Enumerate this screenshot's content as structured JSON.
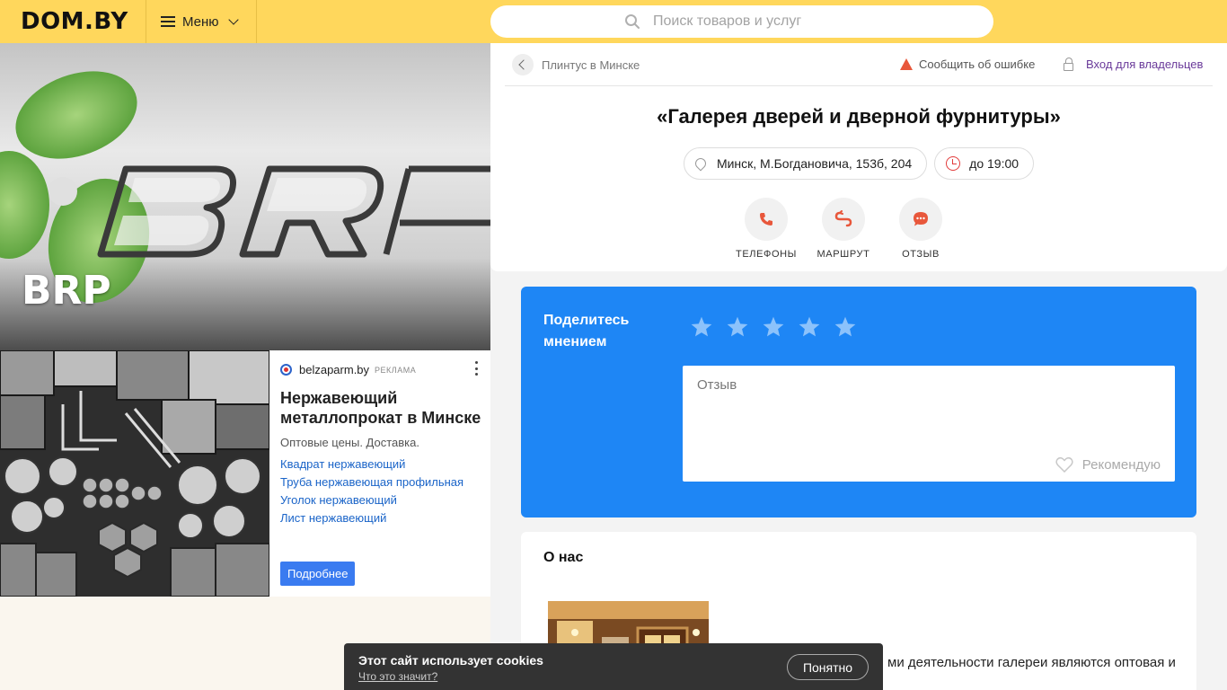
{
  "header": {
    "logo": "DOM.BY",
    "menu_label": "Меню",
    "search_placeholder": "Поиск товаров и услуг"
  },
  "hero": {
    "title": "BRP"
  },
  "ad": {
    "source": "belzaparm.by",
    "tag": "РЕКЛАМА",
    "title": "Нержавеющий металлопрокат в Минске",
    "description": "Оптовые цены. Доставка.",
    "links": [
      "Квадрат нержавеющий",
      "Труба нержавеющая профильная",
      "Уголок нержавеющий",
      "Лист нержавеющий"
    ],
    "button": "Подробнее"
  },
  "card": {
    "breadcrumb": "Плинтус в Минске",
    "report": "Сообщить об ошибке",
    "owners": "Вход для владельцев",
    "title": "«Галерея дверей и дверной фурнитуры»",
    "address": "Минск, М.Богдановича, 153б, 204",
    "hours": "до 19:00",
    "actions": [
      {
        "label": "ТЕЛЕФОНЫ",
        "icon": "phone-icon"
      },
      {
        "label": "МАРШРУТ",
        "icon": "route-icon"
      },
      {
        "label": "ОТЗЫВ",
        "icon": "comment-icon"
      }
    ]
  },
  "review": {
    "title": "Поделитесь мнением",
    "rating_max": 5,
    "placeholder": "Отзыв",
    "recommend": "Рекомендую"
  },
  "about": {
    "title": "О нас",
    "text": "ми деятельности галереи являются оптовая и"
  },
  "cookie": {
    "text": "Этот сайт использует cookies",
    "link": "Что это значит?",
    "button": "Понятно"
  },
  "colors": {
    "header_bg": "#ffd75c",
    "review_bg": "#1e86f5",
    "accent_orange": "#e8573b",
    "owners_link": "#6a3a9a",
    "ad_link": "#1a64c8",
    "ad_button": "#3a7bf0"
  }
}
